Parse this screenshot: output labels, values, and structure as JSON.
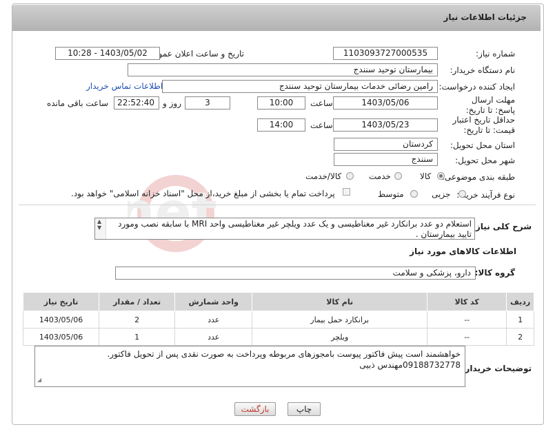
{
  "header": {
    "title": "جزئیات اطلاعات نیاز"
  },
  "fields": {
    "need_number_label": "شماره نیاز:",
    "need_number": "1103093727000535",
    "announce_label": "تاریخ و ساعت اعلان عمومی:",
    "announce_value": "1403/05/02 - 10:28",
    "buyer_org_label": "نام دستگاه خریدار:",
    "buyer_org": "بیمارستان توحید سنندج",
    "requester_label": "ایجاد کننده درخواست:",
    "requester": "رامین رضائی خدمات بیمارستان توحید سنندج",
    "contact_link": "اطلاعات تماس خریدار",
    "deadline_label": "مهلت ارسال پاسخ: تا تاریخ:",
    "deadline_date": "1403/05/06",
    "time_label": "ساعت",
    "deadline_time": "10:00",
    "days": "3",
    "days_label": "روز و",
    "remaining_time": "22:52:40",
    "remaining_label": "ساعت باقی مانده",
    "validity_label": "حداقل تاریخ اعتبار قیمت: تا تاریخ:",
    "validity_date": "1403/05/23",
    "validity_time": "14:00",
    "province_label": "استان محل تحویل:",
    "province": "کردستان",
    "city_label": "شهر محل تحویل:",
    "city": "سنندج",
    "category_label": "طبقه بندی موضوعی:",
    "category_options": [
      "کالا",
      "خدمت",
      "کالا/خدمت"
    ],
    "purchase_label": "نوع فرآیند خرید :",
    "purchase_options": [
      "جزیی",
      "متوسط"
    ],
    "purchase_note": "پرداخت تمام یا بخشی از مبلغ خرید،از محل \"اسناد خزانه اسلامی\" خواهد بود.",
    "summary_label": "شرح کلی نیاز:",
    "summary": "استعلام دو عدد برانکارد غیر مغناطیسی و یک عدد ویلچر غیر مغناطیسی واحد MRI  با سابقه نصب ومورد تایید بیمارستان ."
  },
  "goods": {
    "section_title": "اطلاعات کالاهای مورد نیاز",
    "group_label": "گروه کالا:",
    "group_value": "دارو، پزشکی و سلامت",
    "columns": [
      "ردیف",
      "کد کالا",
      "نام کالا",
      "واحد شمارش",
      "تعداد / مقدار",
      "تاریخ نیاز"
    ],
    "rows": [
      [
        "1",
        "--",
        "برانکارد حمل بیمار",
        "عدد",
        "2",
        "1403/05/06"
      ],
      [
        "2",
        "--",
        "ویلچر",
        "عدد",
        "1",
        "1403/05/06"
      ]
    ]
  },
  "buyer_notes": {
    "label": "توضیحات خریدار:",
    "line1": "خواهشمند است پیش فاکتور پیوست بامجوزهای مربوطه وپرداخت به صورت نقدی پس از تحویل فاکتور.",
    "line2": "09188732778مهندس ذبیی"
  },
  "buttons": {
    "print": "چاپ",
    "back": "بازگشت"
  },
  "watermark": {
    "text": "AriaTender.net"
  },
  "colors": {
    "link": "#1f4fb0",
    "header_bg": "#bdbdbd",
    "back_text": "#c0392b"
  }
}
